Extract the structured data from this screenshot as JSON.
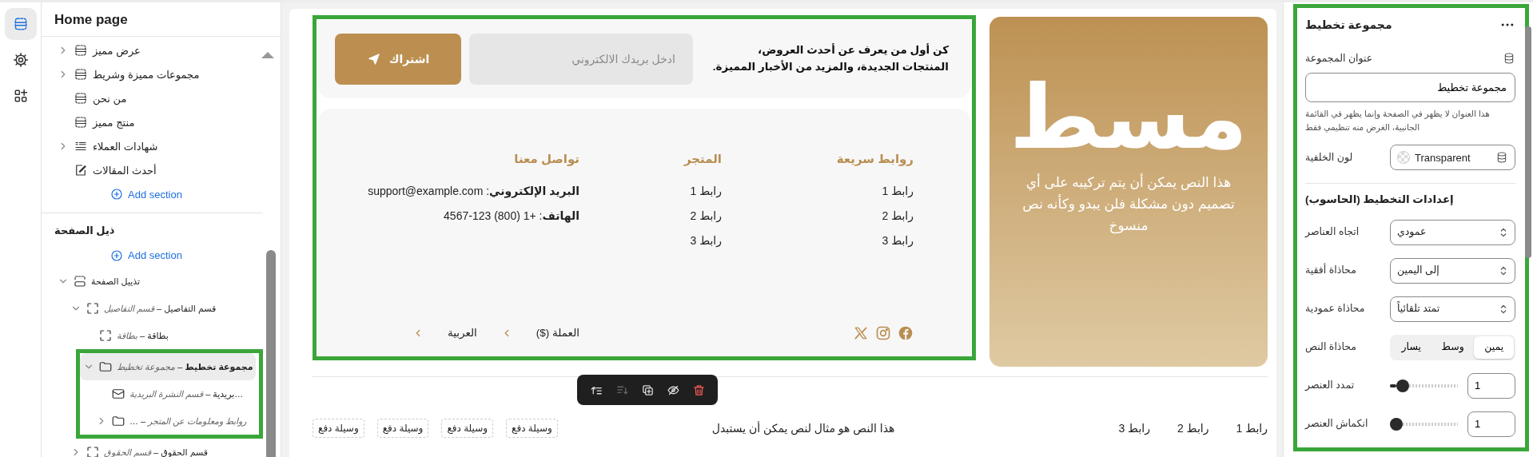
{
  "rail": [
    {
      "kind": "sections",
      "selected": true
    },
    {
      "kind": "settings",
      "selected": false
    },
    {
      "kind": "apps",
      "selected": false
    }
  ],
  "sidebar": {
    "title": "Home page",
    "sections": [
      {
        "label": "عرض مميز",
        "kind": "section",
        "expandable": true,
        "expanded": false
      },
      {
        "label": "مجموعات مميزة وشريط",
        "kind": "section",
        "expandable": true,
        "expanded": false
      },
      {
        "label": "من نحن",
        "kind": "section",
        "expandable": false
      },
      {
        "label": "منتج مميز",
        "kind": "section",
        "expandable": false
      },
      {
        "label": "شهادات العملاء",
        "kind": "testimonials",
        "expandable": true,
        "expanded": false
      },
      {
        "label": "أحدث المقالات",
        "kind": "articles",
        "expandable": false
      }
    ],
    "add_section": "Add section",
    "footer_heading": "ذيل الصفحة",
    "footer_add_section": "Add section",
    "footer_tree": [
      {
        "label": "تذييل الصفحة",
        "kind": "footer",
        "expandable": true,
        "expanded": true,
        "selected": false,
        "outlined": false,
        "children": [
          {
            "label": "قسم التفاصيل – *قسم التفاصيل*",
            "kind": "block",
            "expandable": true,
            "expanded": true,
            "selected": false,
            "outlined": false,
            "children": [
              {
                "label": "بطاقة – *بطاقة*",
                "kind": "block",
                "expandable": false,
                "selected": false,
                "outlined": false
              },
              {
                "label": "**مجموعة تخطيط** – *مجموعة تخطيط*",
                "kind": "folder",
                "expandable": true,
                "expanded": true,
                "selected": true,
                "outlined": true,
                "children": [
                  {
                    "label": "…بريدية – *قسم النشرة البريدية*",
                    "kind": "mail",
                    "expandable": false,
                    "selected": false,
                    "outlined": false
                  },
                  {
                    "label": "*روابط ومعلومات عن المتجر* – …",
                    "kind": "folder",
                    "expandable": true,
                    "expanded": false,
                    "selected": false,
                    "outlined": false
                  }
                ]
              }
            ]
          },
          {
            "label": "قسم الحقوق – *قسم الحقوق*",
            "kind": "block",
            "expandable": true,
            "expanded": false,
            "selected": false,
            "outlined": false
          }
        ]
      }
    ]
  },
  "preview": {
    "outlined": true,
    "newsletter": {
      "text": "كن أول من يعرف عن أحدث العروض،\nالمنتجات الجديدة، والمزيد من الأخبار المميزة.",
      "placeholder": "ادخل بريدك الالكتروني",
      "button": "اشتراك"
    },
    "columns": [
      {
        "heading": "روابط سريعة",
        "items": [
          "رابط 1",
          "رابط 2",
          "رابط 3"
        ]
      },
      {
        "heading": "المتجر",
        "items": [
          "رابط 1",
          "رابط 2",
          "رابط 3"
        ]
      },
      {
        "heading": "تواصل معنا",
        "items": [
          "**البريد الإلكتروني**: support@example.com",
          "**الهاتف**: +1 (800) 123-4567"
        ]
      }
    ],
    "socials": [
      {
        "kind": "facebook"
      },
      {
        "kind": "instagram"
      },
      {
        "kind": "x"
      }
    ],
    "selectors": [
      "العملة ($)",
      "العربية"
    ],
    "brand": {
      "logo": "مسط",
      "text": "هذا النص يمكن أن يتم تركيبه على أي تصميم دون مشكلة فلن يبدو وكأنه نص منسوخ"
    },
    "bottom_links": [
      "رابط 1",
      "رابط 2",
      "رابط 3"
    ],
    "bottom_note": "هذا النص هو مثال لنص يمكن أن يستبدل",
    "payment_badges": [
      "وسيلة دفع",
      "وسيلة دفع",
      "وسيلة دفع",
      "وسيلة دفع"
    ],
    "toolbar": [
      {
        "kind": "move-up",
        "disabled": false
      },
      {
        "kind": "move-down",
        "disabled": true
      },
      {
        "kind": "duplicate",
        "disabled": false
      },
      {
        "kind": "hide",
        "disabled": false
      },
      {
        "kind": "delete",
        "disabled": false
      }
    ]
  },
  "panel": {
    "outlined": true,
    "title": "مجموعة تخطيط",
    "title_field": {
      "label": "عنوان المجموعة",
      "value": "مجموعة تخطيط",
      "help": "هذا العنوان لا يظهر في الصفحة وإنما يظهر في القائمة الجانبية، الغرض منه تنظيمي فقط"
    },
    "background": {
      "label": "لون الخلفية",
      "value": "Transparent"
    },
    "layout_heading": "إعدادات التخطيط (الحاسوب)",
    "settings": [
      {
        "kind": "select",
        "label": "اتجاه العناصر",
        "value": "عمودي"
      },
      {
        "kind": "select",
        "label": "محاذاة أفقية",
        "value": "إلى اليمين"
      },
      {
        "kind": "select",
        "label": "محاذاة عمودية",
        "value": "تمتد تلقائياً"
      },
      {
        "kind": "segmented",
        "label": "محاذاة النص",
        "options": [
          {
            "label": "يمين",
            "selected": true
          },
          {
            "label": "وسط",
            "selected": false
          },
          {
            "label": "يسار",
            "selected": false
          }
        ]
      },
      {
        "kind": "slider",
        "label": "تمدد العنصر",
        "level": 0.12,
        "value": "1"
      },
      {
        "kind": "slider",
        "label": "انكماش العنصر",
        "level": 0,
        "value": "1"
      }
    ]
  }
}
